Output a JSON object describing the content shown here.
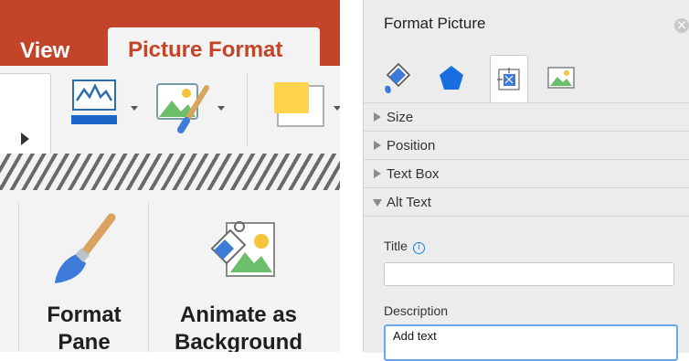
{
  "ribbon": {
    "tabs": [
      {
        "label": "View",
        "active": false
      },
      {
        "label": "Picture Format",
        "active": true
      }
    ],
    "tools": [
      {
        "icon": "picture-border-icon",
        "has_dropdown": true
      },
      {
        "icon": "picture-effects-icon",
        "has_dropdown": true
      },
      {
        "icon": "picture-color-swatch-icon",
        "has_dropdown": true
      }
    ],
    "buttons": [
      {
        "label_line1": "Format",
        "label_line2": "Pane",
        "icon": "paintbrush-icon"
      },
      {
        "label_line1": "Animate as",
        "label_line2": "Background",
        "icon": "animate-background-icon"
      }
    ],
    "colors": {
      "accent": "#c4442a",
      "ribbon_bg": "#f3f3f3"
    }
  },
  "pane": {
    "title": "Format Picture",
    "icon_tabs": [
      {
        "icon": "fill-line-icon",
        "active": false
      },
      {
        "icon": "effects-pentagon-icon",
        "active": false
      },
      {
        "icon": "size-properties-icon",
        "active": true
      },
      {
        "icon": "picture-icon",
        "active": false
      }
    ],
    "sections": [
      {
        "label": "Size",
        "expanded": false
      },
      {
        "label": "Position",
        "expanded": false
      },
      {
        "label": "Text Box",
        "expanded": false
      },
      {
        "label": "Alt Text",
        "expanded": true
      }
    ],
    "alt_text": {
      "title_label": "Title",
      "title_value": "",
      "description_label": "Description",
      "description_placeholder": "Add text"
    },
    "colors": {
      "focus_blue": "#6da6f0",
      "info_blue": "#2a7ae2"
    }
  }
}
